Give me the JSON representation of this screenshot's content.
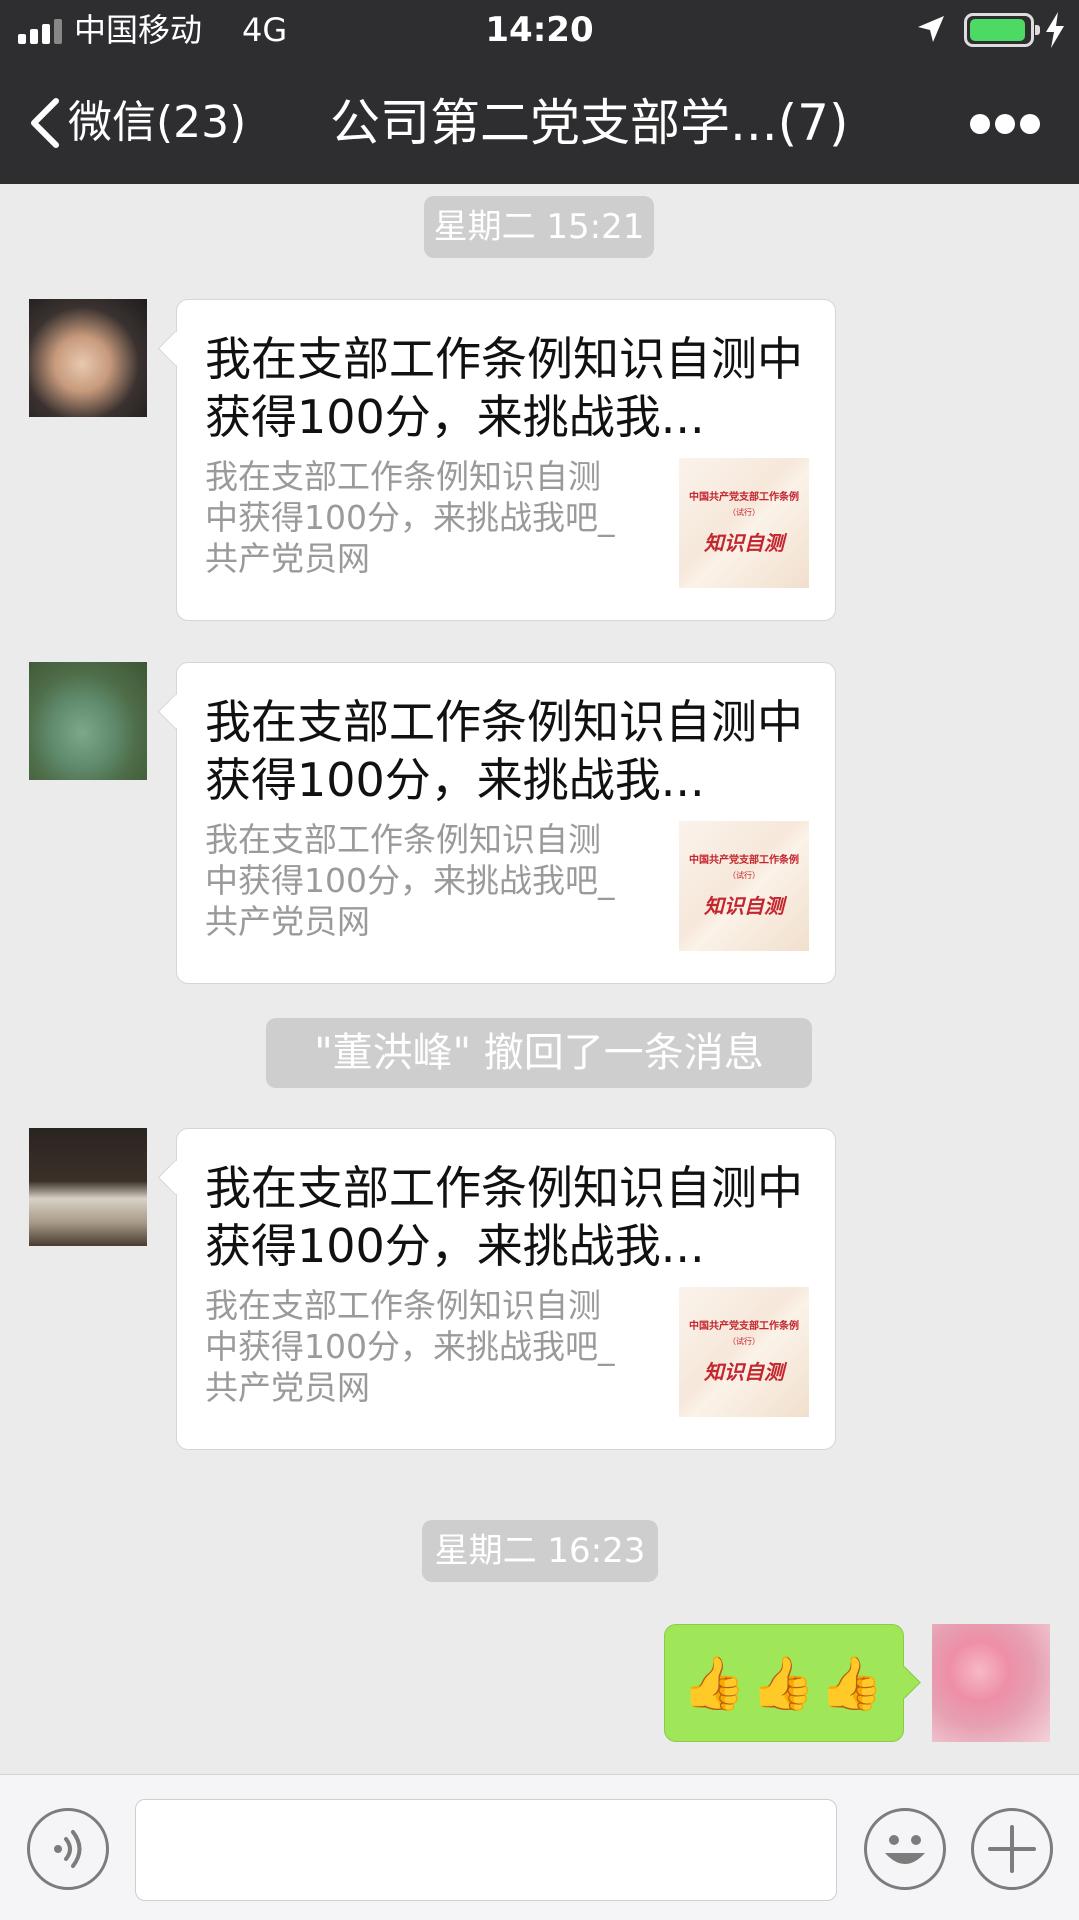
{
  "status_bar": {
    "carrier": "中国移动",
    "network": "4G",
    "time": "14:20",
    "battery_level": 0.95,
    "icons": [
      "signal-icon",
      "location-arrow-icon",
      "battery-icon",
      "charging-bolt-icon"
    ]
  },
  "nav": {
    "back_label": "微信(23)",
    "title": "公司第二党支部学...(7)",
    "icons": [
      "chevron-left-icon",
      "more-dots-icon"
    ]
  },
  "messages": [
    {
      "type": "time",
      "text": "星期二 15:21"
    },
    {
      "type": "card",
      "title": "我在支部工作条例知识自测中获得100分，来挑战我...",
      "description": "我在支部工作条例知识自测\n中获得100分，来挑战我吧_\n共产党员网",
      "thumb": {
        "line1": "中国共产党支部工作条例",
        "line2": "（试行）",
        "line3": "知识自测"
      }
    },
    {
      "type": "card",
      "title": "我在支部工作条例知识自测中获得100分，来挑战我...",
      "description": "我在支部工作条例知识自测\n中获得100分，来挑战我吧_\n共产党员网",
      "thumb": {
        "line1": "中国共产党支部工作条例",
        "line2": "（试行）",
        "line3": "知识自测"
      }
    },
    {
      "type": "system",
      "text": "\"董洪峰\" 撤回了一条消息"
    },
    {
      "type": "card",
      "title": "我在支部工作条例知识自测中获得100分，来挑战我...",
      "description": "我在支部工作条例知识自测\n中获得100分，来挑战我吧_\n共产党员网",
      "thumb": {
        "line1": "中国共产党支部工作条例",
        "line2": "（试行）",
        "line3": "知识自测"
      }
    },
    {
      "type": "time",
      "text": "星期二 16:23"
    },
    {
      "type": "mine",
      "text": "👍👍👍"
    }
  ],
  "input_bar": {
    "value": "",
    "icons": [
      "voice-icon",
      "emoji-icon",
      "plus-icon"
    ]
  },
  "colors": {
    "nav_bg": "#2e2e31",
    "chat_bg": "#ebebeb",
    "my_bubble": "#9fe658",
    "battery": "#4cd964",
    "thumb_red": "#c3262e"
  }
}
